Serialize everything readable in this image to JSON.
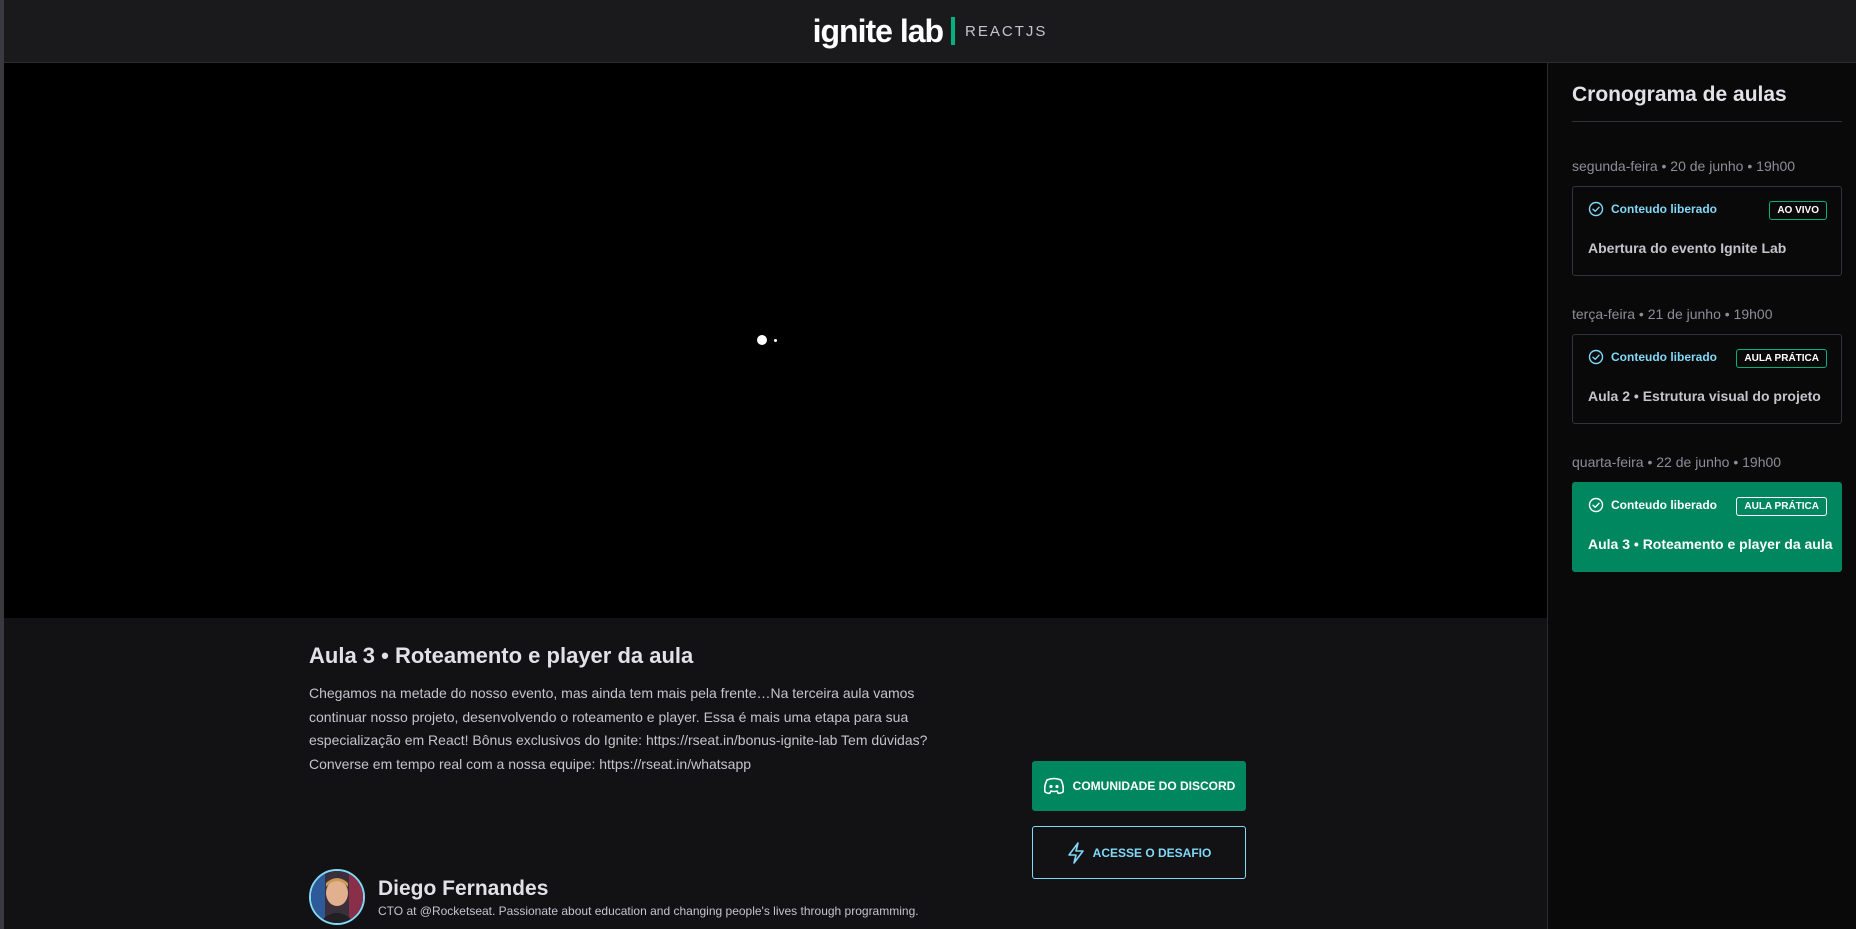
{
  "header": {
    "logo_word": "ignite lab",
    "logo_sub": "REACTJS",
    "accent_color": "#00b37e"
  },
  "player": {
    "state_icon": "loading-spinner-icon"
  },
  "lesson": {
    "title": "Aula 3 • Roteamento e player da aula",
    "description": "Chegamos na metade do nosso evento, mas ainda tem mais pela frente…Na terceira aula vamos continuar nosso projeto, desenvolvendo o roteamento e player. Essa é mais uma etapa para sua especialização em React! Bônus exclusivos do Ignite: https://rseat.in/bonus-ignite-lab Tem dúvidas? Converse em tempo real com a nossa equipe: https://rseat.in/whatsapp",
    "teacher": {
      "name": "Diego Fernandes",
      "bio": "CTO at @Rocketseat. Passionate about education and changing people's lives through programming."
    },
    "buttons": {
      "discord": {
        "label": "COMUNIDADE DO DISCORD",
        "icon": "discord-icon"
      },
      "challenge": {
        "label": "ACESSE O DESAFIO",
        "icon": "lightning-icon"
      }
    }
  },
  "sidebar": {
    "title": "Cronograma de aulas",
    "lessons": [
      {
        "date": "segunda-feira • 20 de junho • 19h00",
        "status": "Conteudo liberado",
        "badge": "AO VIVO",
        "title": "Abertura do evento Ignite Lab",
        "active": false
      },
      {
        "date": "terça-feira • 21 de junho • 19h00",
        "status": "Conteudo liberado",
        "badge": "AULA PRÁTICA",
        "title": "Aula 2 • Estrutura visual do projeto",
        "active": false
      },
      {
        "date": "quarta-feira • 22 de junho • 19h00",
        "status": "Conteudo liberado",
        "badge": "AULA PRÁTICA",
        "title": "Aula 3 • Roteamento e player da aula",
        "active": true
      }
    ]
  },
  "colors": {
    "background": "#121214",
    "sidebar_background": "#09090a",
    "green": "#00875f",
    "blue": "#81d8f7"
  }
}
